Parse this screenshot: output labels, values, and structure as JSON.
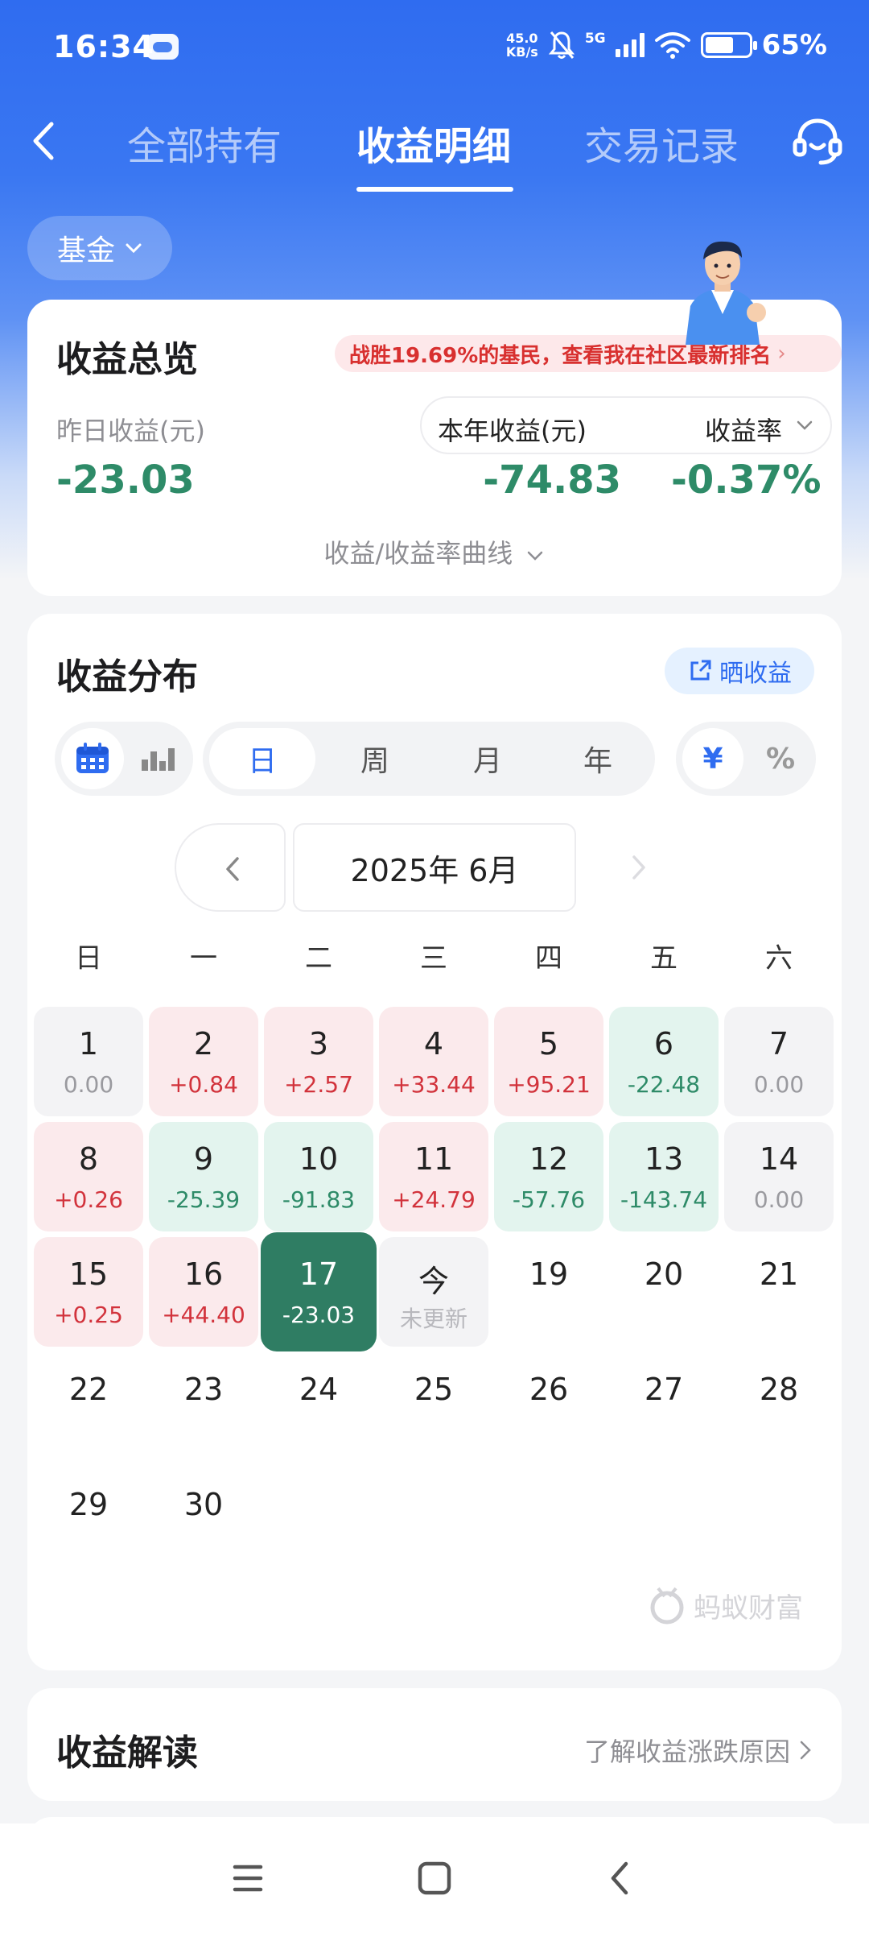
{
  "status_bar": {
    "time": "16:34",
    "net_speed_value": "45.0",
    "net_speed_unit": "KB/s",
    "network": "5G",
    "battery_percent": "65%",
    "battery_level": 0.65
  },
  "nav": {
    "tabs": [
      {
        "label": "全部持有"
      },
      {
        "label": "收益明细"
      },
      {
        "label": "交易记录"
      }
    ],
    "active_tab": "收益明细"
  },
  "filter_chip": {
    "label": "基金"
  },
  "overview": {
    "title": "收益总览",
    "banner": "战胜19.69%的基民，查看我在社区最新排名",
    "yesterday_label": "昨日收益(元)",
    "yesterday_value": "-23.03",
    "annual_label": "本年收益(元)",
    "rate_label": "收益率",
    "annual_value": "-74.83",
    "rate_value": "-0.37%",
    "curve_link": "收益/收益率曲线"
  },
  "distribution": {
    "title": "收益分布",
    "share_label": "晒收益",
    "period_options": [
      "日",
      "周",
      "月",
      "年"
    ],
    "active_period": "日",
    "unit_options": [
      "¥",
      "%"
    ],
    "active_unit": "¥",
    "month_label": "2025年 6月",
    "weekdays": [
      "日",
      "一",
      "二",
      "三",
      "四",
      "五",
      "六"
    ],
    "days": [
      {
        "day": "1",
        "value": "0.00",
        "state": "zero"
      },
      {
        "day": "2",
        "value": "+0.84",
        "state": "up"
      },
      {
        "day": "3",
        "value": "+2.57",
        "state": "up"
      },
      {
        "day": "4",
        "value": "+33.44",
        "state": "up"
      },
      {
        "day": "5",
        "value": "+95.21",
        "state": "up"
      },
      {
        "day": "6",
        "value": "-22.48",
        "state": "down"
      },
      {
        "day": "7",
        "value": "0.00",
        "state": "zero"
      },
      {
        "day": "8",
        "value": "+0.26",
        "state": "up"
      },
      {
        "day": "9",
        "value": "-25.39",
        "state": "down"
      },
      {
        "day": "10",
        "value": "-91.83",
        "state": "down"
      },
      {
        "day": "11",
        "value": "+24.79",
        "state": "up"
      },
      {
        "day": "12",
        "value": "-57.76",
        "state": "down"
      },
      {
        "day": "13",
        "value": "-143.74",
        "state": "down"
      },
      {
        "day": "14",
        "value": "0.00",
        "state": "zero"
      },
      {
        "day": "15",
        "value": "+0.25",
        "state": "up"
      },
      {
        "day": "16",
        "value": "+44.40",
        "state": "up"
      },
      {
        "day": "17",
        "value": "-23.03",
        "state": "selected"
      },
      {
        "day": "今",
        "value": "未更新",
        "state": "today"
      },
      {
        "day": "19",
        "value": "",
        "state": "future"
      },
      {
        "day": "20",
        "value": "",
        "state": "future"
      },
      {
        "day": "21",
        "value": "",
        "state": "future"
      },
      {
        "day": "22",
        "value": "",
        "state": "future"
      },
      {
        "day": "23",
        "value": "",
        "state": "future"
      },
      {
        "day": "24",
        "value": "",
        "state": "future"
      },
      {
        "day": "25",
        "value": "",
        "state": "future"
      },
      {
        "day": "26",
        "value": "",
        "state": "future"
      },
      {
        "day": "27",
        "value": "",
        "state": "future"
      },
      {
        "day": "28",
        "value": "",
        "state": "future"
      },
      {
        "day": "29",
        "value": "",
        "state": "future"
      },
      {
        "day": "30",
        "value": "",
        "state": "future"
      }
    ],
    "watermark": "蚂蚁财富"
  },
  "interpretation": {
    "title": "收益解读",
    "link": "了解收益涨跌原因"
  },
  "colors": {
    "primary": "#2f6cf0",
    "gain": "#d2333c",
    "loss": "#2e8b68",
    "selected_day": "#2f7d63"
  },
  "icons": [
    "cloud-icon",
    "mute-bell-icon",
    "signal-icon",
    "wifi-icon",
    "battery-icon",
    "back-icon",
    "customer-service-icon",
    "chevron-down-icon",
    "share-icon",
    "calendar-icon",
    "bar-chart-icon",
    "chevron-left-icon",
    "chevron-right-icon",
    "chevron-right-small-icon",
    "menu-icon",
    "home-square-icon",
    "system-back-icon"
  ]
}
